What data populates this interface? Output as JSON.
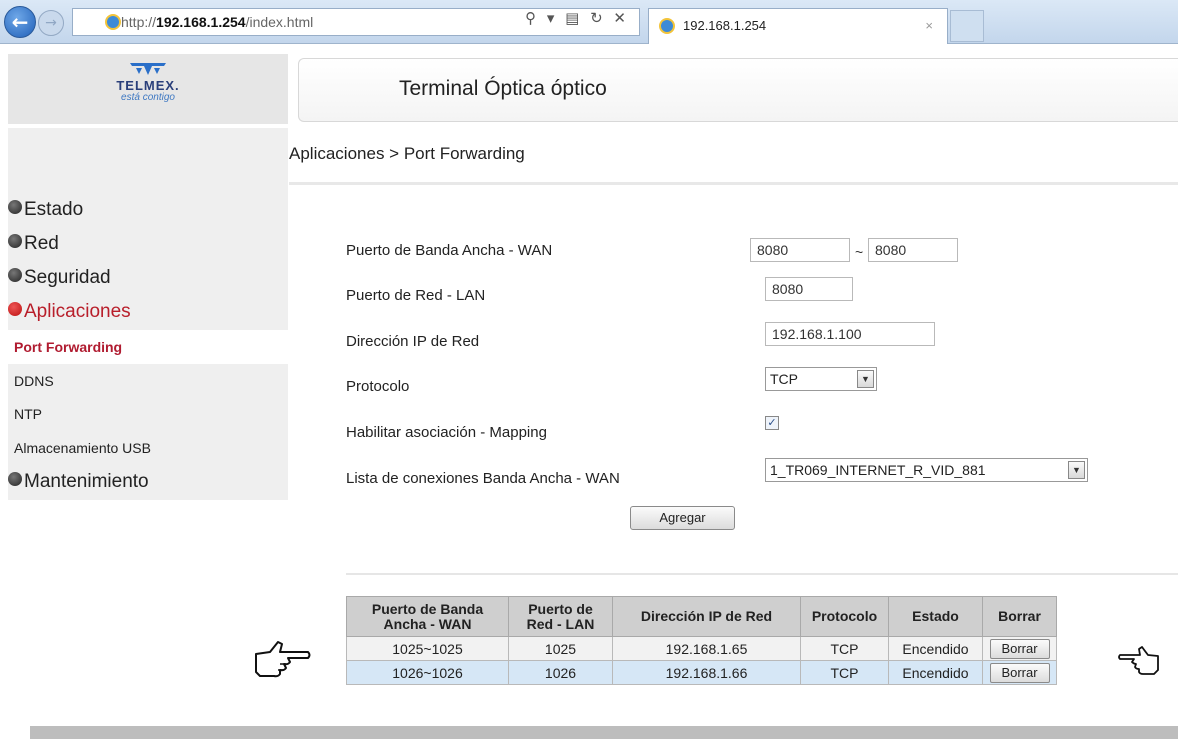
{
  "browser": {
    "url_prefix": "http://",
    "url_host": "192.168.1.254",
    "url_path": "/index.html",
    "address_controls": "⚲ ▾ ▤ ↻ ✕",
    "tab_title": "192.168.1.254",
    "tab_close": "×"
  },
  "header": {
    "logo_text": "TELMEX.",
    "logo_sub": "está contigo",
    "title": "Terminal Óptica óptico"
  },
  "breadcrumb": "Aplicaciones > Port Forwarding",
  "menu": {
    "items": [
      {
        "label": "Estado"
      },
      {
        "label": "Red"
      },
      {
        "label": "Seguridad"
      },
      {
        "label": "Aplicaciones"
      },
      {
        "label": "Mantenimiento"
      }
    ],
    "submenu": [
      {
        "label": "Port Forwarding"
      },
      {
        "label": "DDNS"
      },
      {
        "label": "NTP"
      },
      {
        "label": "Almacenamiento USB"
      }
    ]
  },
  "form": {
    "wan_label": "Puerto de Banda Ancha - WAN",
    "wan_start": "8080",
    "wan_sep": "~",
    "wan_end": "8080",
    "lan_label": "Puerto de Red - LAN",
    "lan_port": "8080",
    "ip_label": "Dirección IP de Red",
    "ip_value": "192.168.1.100",
    "proto_label": "Protocolo",
    "proto_value": "TCP",
    "mapping_label": "Habilitar asociación - Mapping",
    "mapping_checked": true,
    "mapping_mark": "✓",
    "wanlist_label": "Lista de conexiones Banda Ancha - WAN",
    "wanlist_value": "1_TR069_INTERNET_R_VID_881",
    "dropdown_arrow": "▼",
    "add_button": "Agregar"
  },
  "table": {
    "headers": {
      "wan_line1": "Puerto de Banda",
      "wan_line2": "Ancha - WAN",
      "lan_line1": "Puerto de",
      "lan_line2": "Red - LAN",
      "ip": "Dirección IP de Red",
      "proto": "Protocolo",
      "state": "Estado",
      "delete": "Borrar"
    },
    "rows": [
      {
        "wan": "1025~1025",
        "lan": "1025",
        "ip": "192.168.1.65",
        "proto": "TCP",
        "state": "Encendido",
        "delete": "Borrar"
      },
      {
        "wan": "1026~1026",
        "lan": "1026",
        "ip": "192.168.1.66",
        "proto": "TCP",
        "state": "Encendido",
        "delete": "Borrar"
      }
    ]
  },
  "icons": {
    "back": "arrow-left-icon",
    "forward": "arrow-right-icon",
    "browser": "internet-explorer-icon",
    "bullet": "circle-bullet-icon",
    "hand_left": "pointing-hand-right-icon",
    "hand_right": "pointing-hand-left-icon"
  },
  "colors": {
    "accent_red": "#b81e2a",
    "row_highlight": "#d6e7f6",
    "header_gray": "#cfcfcf"
  }
}
